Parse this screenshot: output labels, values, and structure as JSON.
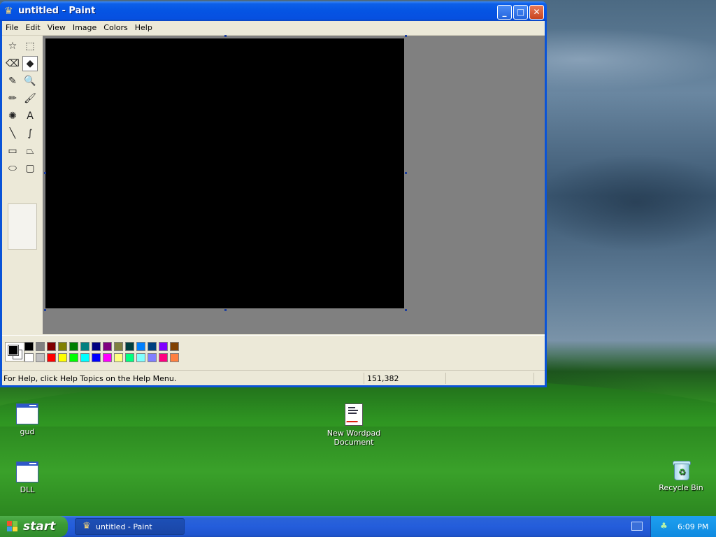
{
  "window": {
    "title": "untitled - Paint",
    "controls": {
      "minimize": "_",
      "maximize": "□",
      "close": "✕"
    }
  },
  "menu": [
    "File",
    "Edit",
    "View",
    "Image",
    "Colors",
    "Help"
  ],
  "tools": [
    {
      "name": "free-form-select",
      "glyph": "☆"
    },
    {
      "name": "select",
      "glyph": "⬚"
    },
    {
      "name": "eraser",
      "glyph": "⌫"
    },
    {
      "name": "fill-with-color",
      "glyph": "◆",
      "active": true
    },
    {
      "name": "pick-color",
      "glyph": "✎"
    },
    {
      "name": "magnifier",
      "glyph": "🔍"
    },
    {
      "name": "pencil",
      "glyph": "✏"
    },
    {
      "name": "brush",
      "glyph": "🖌"
    },
    {
      "name": "airbrush",
      "glyph": "✺"
    },
    {
      "name": "text",
      "glyph": "A"
    },
    {
      "name": "line",
      "glyph": "╲"
    },
    {
      "name": "curve",
      "glyph": "∫"
    },
    {
      "name": "rectangle",
      "glyph": "▭"
    },
    {
      "name": "polygon",
      "glyph": "⏢"
    },
    {
      "name": "ellipse",
      "glyph": "⬭"
    },
    {
      "name": "rounded-rectangle",
      "glyph": "▢"
    }
  ],
  "palette": {
    "foreground": "#000000",
    "background": "#ffffff",
    "row1": [
      "#000000",
      "#808080",
      "#800000",
      "#808000",
      "#008000",
      "#008080",
      "#000080",
      "#800080",
      "#808040",
      "#004040",
      "#0080ff",
      "#004080",
      "#8000ff",
      "#804000"
    ],
    "row2": [
      "#ffffff",
      "#c0c0c0",
      "#ff0000",
      "#ffff00",
      "#00ff00",
      "#00ffff",
      "#0000ff",
      "#ff00ff",
      "#ffff80",
      "#00ff80",
      "#80ffff",
      "#8080ff",
      "#ff0080",
      "#ff8040"
    ]
  },
  "canvas": {
    "fill": "#000000"
  },
  "status": {
    "message": "For Help, click Help Topics on the Help Menu.",
    "coords": "151,382"
  },
  "desktop_icons": [
    {
      "label": "gud"
    },
    {
      "label": "DLL"
    },
    {
      "label": "New Wordpad Document"
    },
    {
      "label": "Recycle Bin"
    }
  ],
  "taskbar": {
    "start_label": "start",
    "task_label": "untitled - Paint",
    "clock": "6:09 PM"
  }
}
